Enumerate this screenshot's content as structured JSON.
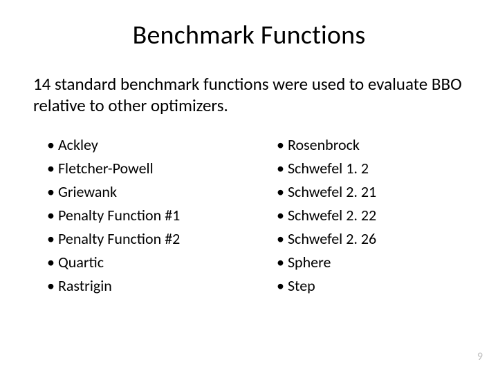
{
  "title": "Benchmark Functions",
  "subtitle": "14 standard benchmark functions were used to evaluate BBO relative to other optimizers.",
  "bullet": "•",
  "columns": {
    "left": [
      "Ackley",
      "Fletcher-Powell",
      "Griewank",
      "Penalty Function #1",
      "Penalty Function #2",
      "Quartic",
      "Rastrigin"
    ],
    "right": [
      "Rosenbrock",
      "Schwefel 1. 2",
      "Schwefel 2. 21",
      "Schwefel 2. 22",
      "Schwefel 2. 26",
      "Sphere",
      "Step"
    ]
  },
  "page_number": "9"
}
